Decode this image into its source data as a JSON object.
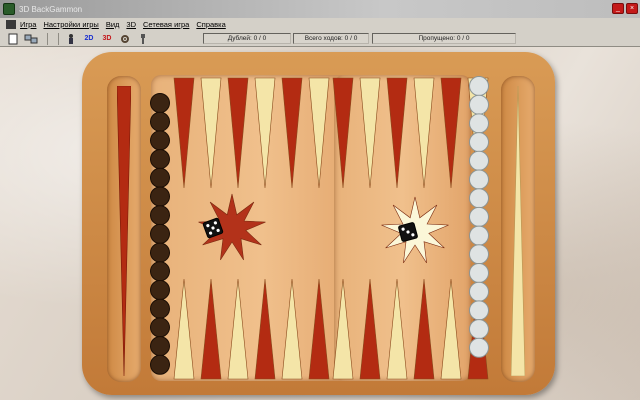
{
  "window": {
    "title": "3D BackGammon",
    "minimize": "_",
    "close": "×"
  },
  "menu": [
    "Игра",
    "Настройки игры",
    "Вид",
    "3D",
    "Сетевая игра",
    "Справка"
  ],
  "toolbar": {
    "view_2d": "2D",
    "view_3d": "3D",
    "counters": {
      "doubles": "Дублей: 0 / 0",
      "total": "Всего ходов: 0 / 0",
      "skipped": "Пропущено: 0 / 0"
    }
  },
  "board": {
    "colors": {
      "dark_point": "#b32b12",
      "light_point": "#f4e5a8",
      "dark_checker": "#3b2412",
      "light_checker": "#dfe3e3"
    },
    "dice": [
      {
        "pips": 5
      },
      {
        "pips": 3
      }
    ]
  }
}
